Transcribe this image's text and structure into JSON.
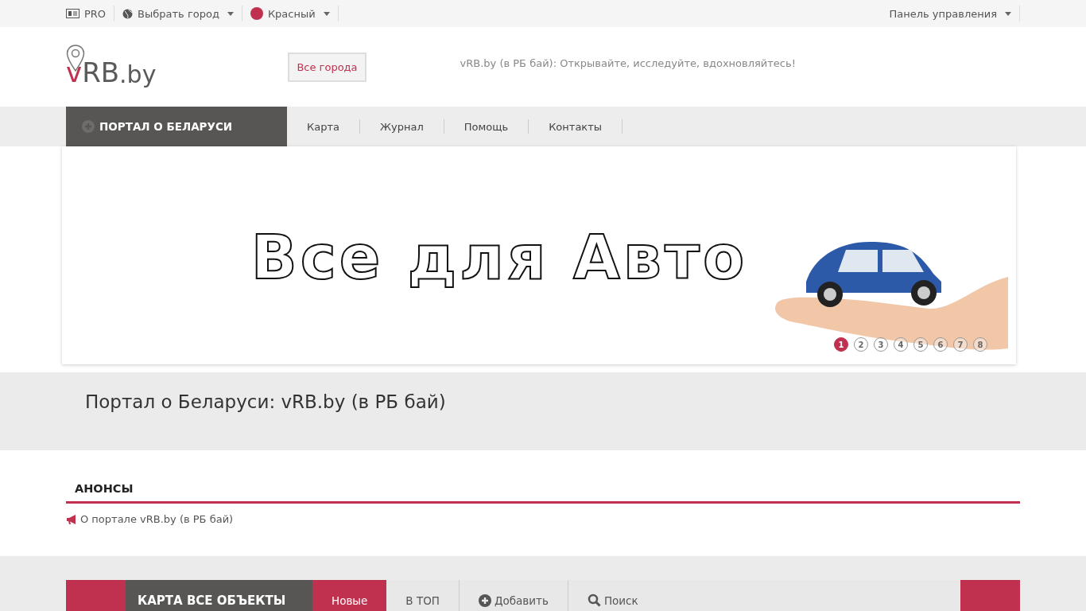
{
  "top_bar": {
    "left": [
      {
        "kind": "pro",
        "label": "PRO"
      },
      {
        "kind": "city",
        "label": "Выбрать город"
      },
      {
        "kind": "theme",
        "label": "Красный",
        "color": "#c0304f"
      }
    ],
    "right": {
      "label": "Панель управления"
    }
  },
  "header": {
    "logo": {
      "accent": "v",
      "rest": "RB",
      "suffix": ".by"
    },
    "city_button": "Все города",
    "slogan": "vRB.by (в РБ бай): Открывайте, исследуйте, вдохновляйтесь!"
  },
  "nav": {
    "portal": "ПОРТАЛ О БЕЛАРУСИ",
    "items": [
      "Карта",
      "Журнал",
      "Помощь",
      "Контакты"
    ]
  },
  "banner": {
    "title": "Все для Авто",
    "dots": [
      {
        "label": "1",
        "selected": true
      },
      {
        "label": "2",
        "selected": false
      },
      {
        "label": "3",
        "selected": false
      },
      {
        "label": "4",
        "selected": false
      },
      {
        "label": "5",
        "selected": false
      },
      {
        "label": "6",
        "selected": false
      },
      {
        "label": "7",
        "selected": false
      },
      {
        "label": "8",
        "selected": false
      }
    ]
  },
  "page_title": "Портал о Беларуси: vRB.by (в РБ бай)",
  "announcements": {
    "heading": "АНОНСЫ",
    "items": [
      "О портале vRB.by (в РБ бай)"
    ]
  },
  "map_bar": {
    "title": "КАРТА ВСЕ ОБЪЕКТЫ",
    "tabs": [
      {
        "kind": "tab",
        "label": "Новые",
        "selected": true
      },
      {
        "kind": "tab",
        "label": "В ТОП",
        "selected": false
      },
      {
        "kind": "add",
        "label": "Добавить",
        "selected": false
      },
      {
        "kind": "search",
        "label": "Поиск",
        "selected": false
      }
    ]
  }
}
